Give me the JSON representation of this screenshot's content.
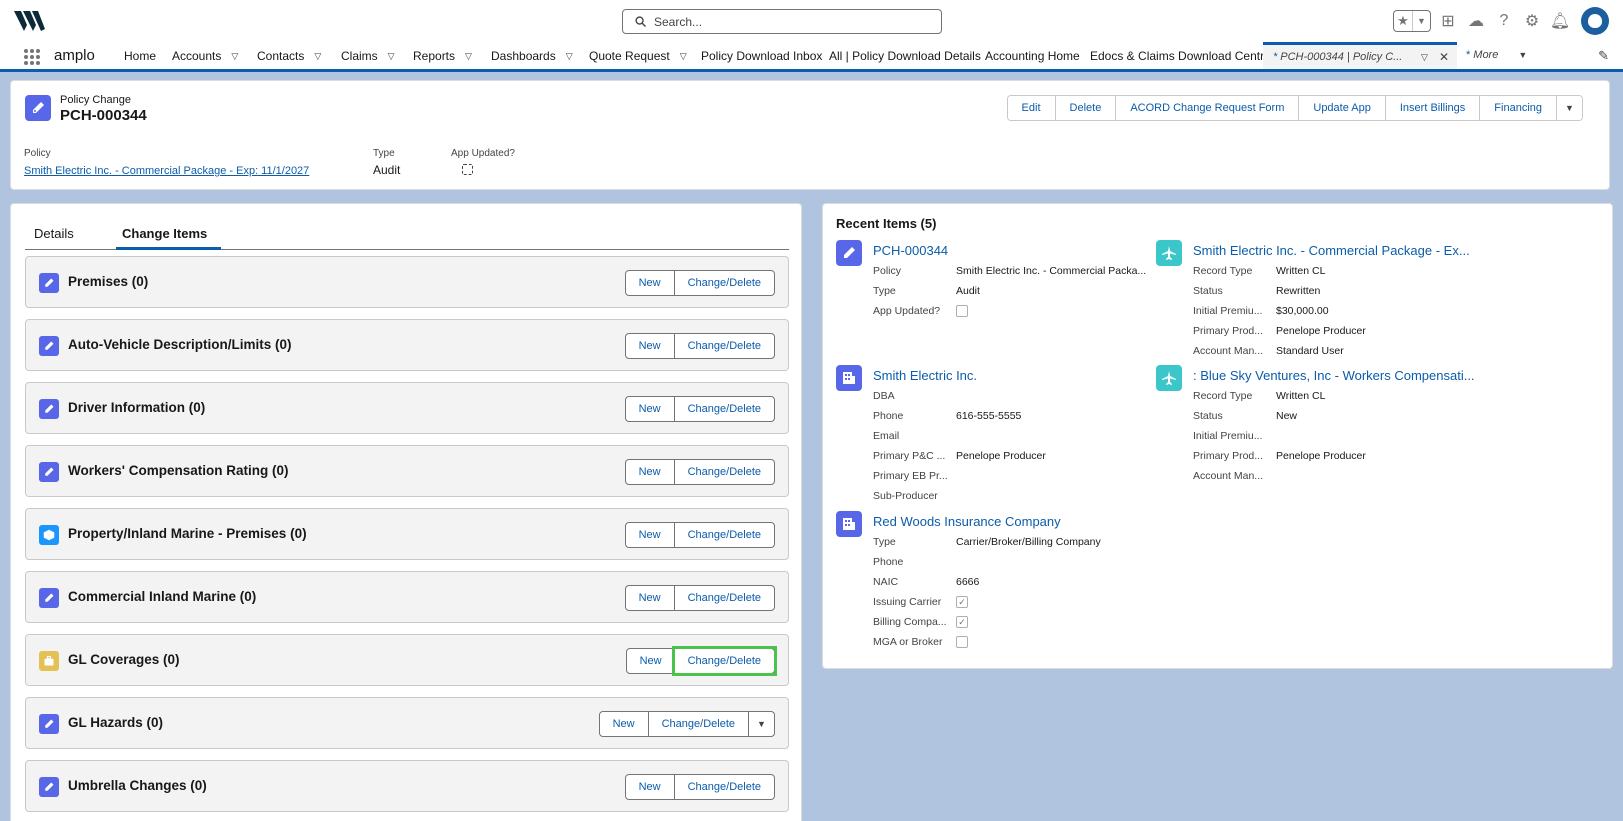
{
  "global": {
    "search_placeholder": "Search...",
    "app_name": "amplo"
  },
  "nav": {
    "items": [
      "Home",
      "Accounts",
      "Contacts",
      "Claims",
      "Reports",
      "Dashboards",
      "Quote Request",
      "Policy Download Inbox",
      "All | Policy Download Details",
      "Accounting Home",
      "Edocs & Claims Download Central"
    ],
    "active_tab": "PCH-000344 | Policy C...",
    "more": "More"
  },
  "record": {
    "object_type": "Policy Change",
    "name": "PCH-000344",
    "actions": [
      "Edit",
      "Delete",
      "ACORD Change Request Form",
      "Update App",
      "Insert Billings",
      "Financing"
    ],
    "fields": {
      "policy_label": "Policy",
      "policy_value": "Smith Electric Inc. - Commercial Package - Exp: 11/1/2027",
      "type_label": "Type",
      "type_value": "Audit",
      "app_updated_label": "App Updated?"
    }
  },
  "tabs": {
    "details": "Details",
    "change_items": "Change Items"
  },
  "sections": [
    {
      "title": "Premises (0)",
      "new": "New",
      "change": "Change/Delete"
    },
    {
      "title": "Auto-Vehicle Description/Limits (0)",
      "new": "New",
      "change": "Change/Delete"
    },
    {
      "title": "Driver Information (0)",
      "new": "New",
      "change": "Change/Delete"
    },
    {
      "title": "Workers' Compensation Rating (0)",
      "new": "New",
      "change": "Change/Delete"
    },
    {
      "title": "Property/Inland Marine - Premises (0)",
      "new": "New",
      "change": "Change/Delete"
    },
    {
      "title": "Commercial Inland Marine (0)",
      "new": "New",
      "change": "Change/Delete"
    },
    {
      "title": "GL Coverages (0)",
      "new": "New",
      "change": "Change/Delete"
    },
    {
      "title": "GL Hazards (0)",
      "new": "New",
      "change": "Change/Delete"
    },
    {
      "title": "Umbrella Changes (0)",
      "new": "New",
      "change": "Change/Delete"
    }
  ],
  "recent": {
    "title": "Recent Items (5)",
    "items": [
      {
        "title": "PCH-000344",
        "rows": [
          [
            "Policy",
            "Smith Electric Inc. - Commercial Packa..."
          ],
          [
            "Type",
            "Audit"
          ],
          [
            "App Updated?",
            ""
          ]
        ]
      },
      {
        "title": "Smith Electric Inc. - Commercial Package - Ex...",
        "rows": [
          [
            "Record Type",
            "Written CL"
          ],
          [
            "Status",
            "Rewritten"
          ],
          [
            "Initial Premiu...",
            "$30,000.00"
          ],
          [
            "Primary Prod...",
            "Penelope Producer"
          ],
          [
            "Account Man...",
            "Standard User"
          ]
        ]
      },
      {
        "title": "Smith Electric Inc.",
        "rows": [
          [
            "DBA",
            ""
          ],
          [
            "Phone",
            "616-555-5555"
          ],
          [
            "Email",
            ""
          ],
          [
            "Primary P&C ...",
            "Penelope Producer"
          ],
          [
            "Primary EB Pr...",
            ""
          ],
          [
            "Sub-Producer",
            ""
          ]
        ]
      },
      {
        "title": ": Blue Sky Ventures, Inc - Workers Compensati...",
        "rows": [
          [
            "Record Type",
            "Written CL"
          ],
          [
            "Status",
            "New"
          ],
          [
            "Initial Premiu...",
            ""
          ],
          [
            "Primary Prod...",
            "Penelope Producer"
          ],
          [
            "Account Man...",
            ""
          ]
        ]
      },
      {
        "title": "Red Woods Insurance Company",
        "rows": [
          [
            "Type",
            "Carrier/Broker/Billing Company"
          ],
          [
            "Phone",
            ""
          ],
          [
            "NAIC",
            "6666"
          ],
          [
            "Issuing Carrier",
            ""
          ],
          [
            "Billing Compa...",
            ""
          ],
          [
            "MGA or Broker",
            ""
          ]
        ]
      }
    ]
  }
}
